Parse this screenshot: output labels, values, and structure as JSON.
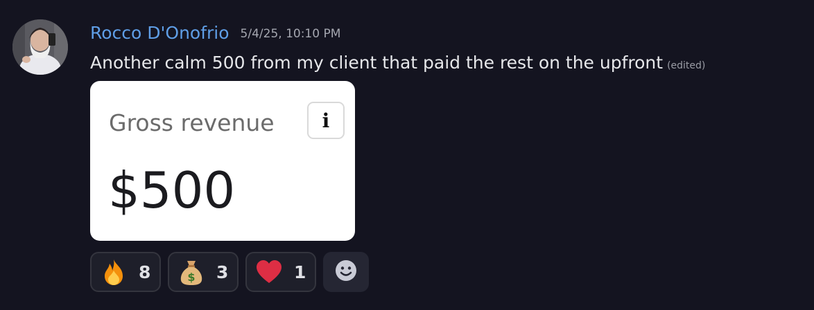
{
  "message": {
    "author": "Rocco D'Onofrio",
    "timestamp": "5/4/25, 10:10 PM",
    "text": "Another calm 500 from my client that paid the rest on the upfront",
    "edited_label": "(edited)"
  },
  "attachment": {
    "title": "Gross revenue",
    "info_icon_glyph": "i",
    "value": "$500"
  },
  "reactions": [
    {
      "emoji": "fire",
      "count": "8"
    },
    {
      "emoji": "money-bag",
      "count": "3"
    },
    {
      "emoji": "red-heart",
      "count": "1"
    }
  ],
  "add_reaction_icon": "smiley-icon",
  "colors": {
    "background": "#141420",
    "username": "#5f9ee6",
    "reaction_bg": "#1e1f2a",
    "reaction_border": "#34353e"
  }
}
